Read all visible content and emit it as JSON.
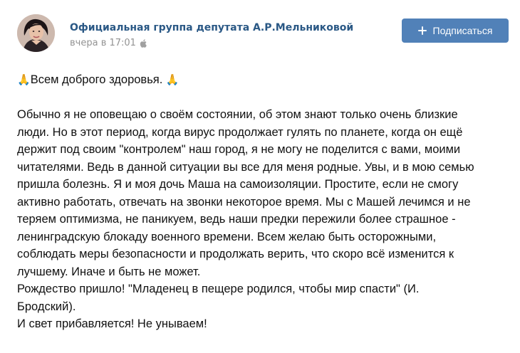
{
  "post": {
    "author": "Официальная группа депутата А.Р.Мельниковой",
    "time": "вчера в 17:01",
    "platform_icon": "apple-icon",
    "subscribe_label": "Подписаться",
    "subscribe_icon": "plus-icon",
    "accent_color": "#5181b8",
    "link_color": "#2a5885",
    "greeting": {
      "emoji_left": "🙏",
      "text": "Всем доброго здоровья. ",
      "emoji_right": "🙏"
    },
    "lines": [
      "Обычно я не оповещаю о своём состоянии, об этом знают только очень близкие",
      "люди. Но в этот период, когда вирус продолжает гулять по планете, когда он ещё",
      "держит под своим \"контролем\" наш город, я не могу не поделится с вами, моими",
      "читателями. Ведь в данной ситуации вы все для меня родные. Увы, и в мою семью",
      "пришла болезнь. Я и моя дочь Маша на самоизоляции. Простите, если не смогу",
      "активно работать, отвечать на звонки некоторое время. Мы с Машей лечимся и не",
      "теряем оптимизма, не паникуем, ведь наши предки пережили более страшное -",
      "ленинградскую блокаду военного времени. Всем желаю быть осторожными,",
      "соблюдать меры безопасности и продолжать верить, что скоро всё изменится к",
      "лучшему. Иначе и быть не может.",
      "Рождество пришло! \"Младенец в пещере родился, чтобы мир спасти\" (И.",
      "Бродский).",
      "И свет прибавляется! Не унываем!"
    ]
  }
}
